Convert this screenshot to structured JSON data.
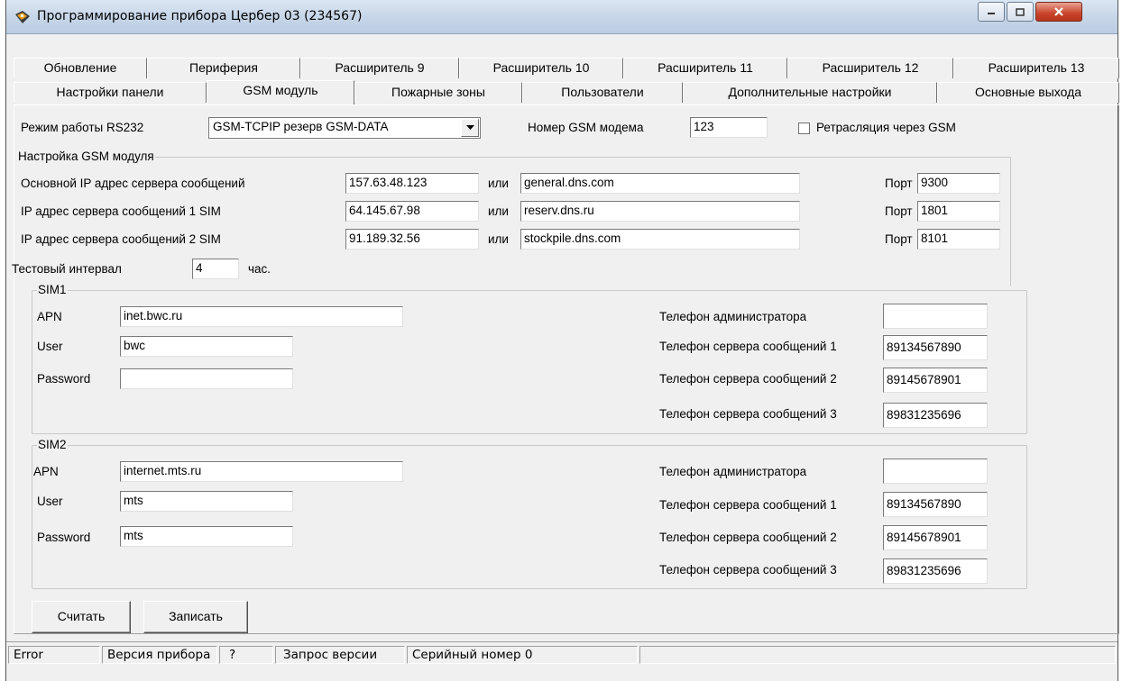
{
  "window": {
    "title": "Программирование прибора Цербер 03 (234567)"
  },
  "tabs": {
    "row1": [
      "Обновление",
      "Периферия",
      "Расширитель 9",
      "Расширитель 10",
      "Расширитель 11",
      "Расширитель 12",
      "Расширитель 13"
    ],
    "row2": [
      "Настройки панели",
      "GSM модуль",
      "Пожарные зоны",
      "Пользователи",
      "Дополнительные настройки",
      "Основные выхода"
    ],
    "active": "GSM модуль"
  },
  "top": {
    "rs232_label": "Режим работы RS232",
    "rs232_value": "GSM-TCPIP резерв GSM-DATA",
    "gsm_number_label": "Номер GSM модема",
    "gsm_number_value": "123",
    "relay_label": "Ретрасляция через GSM",
    "relay_checked": false
  },
  "gsm_settings": {
    "title": "Настройка GSM модуля",
    "or_label": "или",
    "port_label": "Порт",
    "rows": [
      {
        "label": "Основной IP адрес сервера сообщений",
        "ip": "157.63.48.123",
        "dns": "general.dns.com",
        "port": "9300"
      },
      {
        "label": "IP адрес сервера сообщений 1 SIM",
        "ip": "64.145.67.98",
        "dns": "reserv.dns.ru",
        "port": "1801"
      },
      {
        "label": "IP адрес сервера сообщений 2 SIM",
        "ip": "91.189.32.56",
        "dns": "stockpile.dns.com",
        "port": "8101"
      }
    ],
    "test_interval_label": "Тестовый интервал",
    "test_interval_value": "4",
    "test_interval_unit": "час."
  },
  "sim1": {
    "title": "SIM1",
    "apn_label": "APN",
    "apn": "inet.bwc.ru",
    "user_label": "User",
    "user": "bwc",
    "password_label": "Password",
    "password": "",
    "admin_phone_label": "Телефон администратора",
    "admin_phone": "",
    "server_phone_1_label": "Телефон сервера сообщений 1",
    "server_phone_1": "89134567890",
    "server_phone_2_label": "Телефон сервера сообщений 2",
    "server_phone_2": "89145678901",
    "server_phone_3_label": "Телефон сервера сообщений 3",
    "server_phone_3": "89831235696"
  },
  "sim2": {
    "title": "SIM2",
    "apn_label": "APN",
    "apn": "internet.mts.ru",
    "user_label": "User",
    "user": "mts",
    "password_label": "Password",
    "password": "mts",
    "admin_phone_label": "Телефон администратора",
    "admin_phone": "",
    "server_phone_1_label": "Телефон сервера сообщений 1",
    "server_phone_1": "89134567890",
    "server_phone_2_label": "Телефон сервера сообщений 2",
    "server_phone_2": "89145678901",
    "server_phone_3_label": "Телефон сервера сообщений 3",
    "server_phone_3": "89831235696"
  },
  "buttons": {
    "read": "Считать",
    "write": "Записать"
  },
  "status": {
    "error": "Error",
    "device_version": "Версия прибора",
    "question": "?",
    "version_request": "Запрос версии",
    "serial": "Серийный номер 0",
    "empty": ""
  },
  "colors": {
    "window_bg": "#f0f0f0",
    "titlebar": "#c7d6e8",
    "close_button": "#c9432a"
  }
}
